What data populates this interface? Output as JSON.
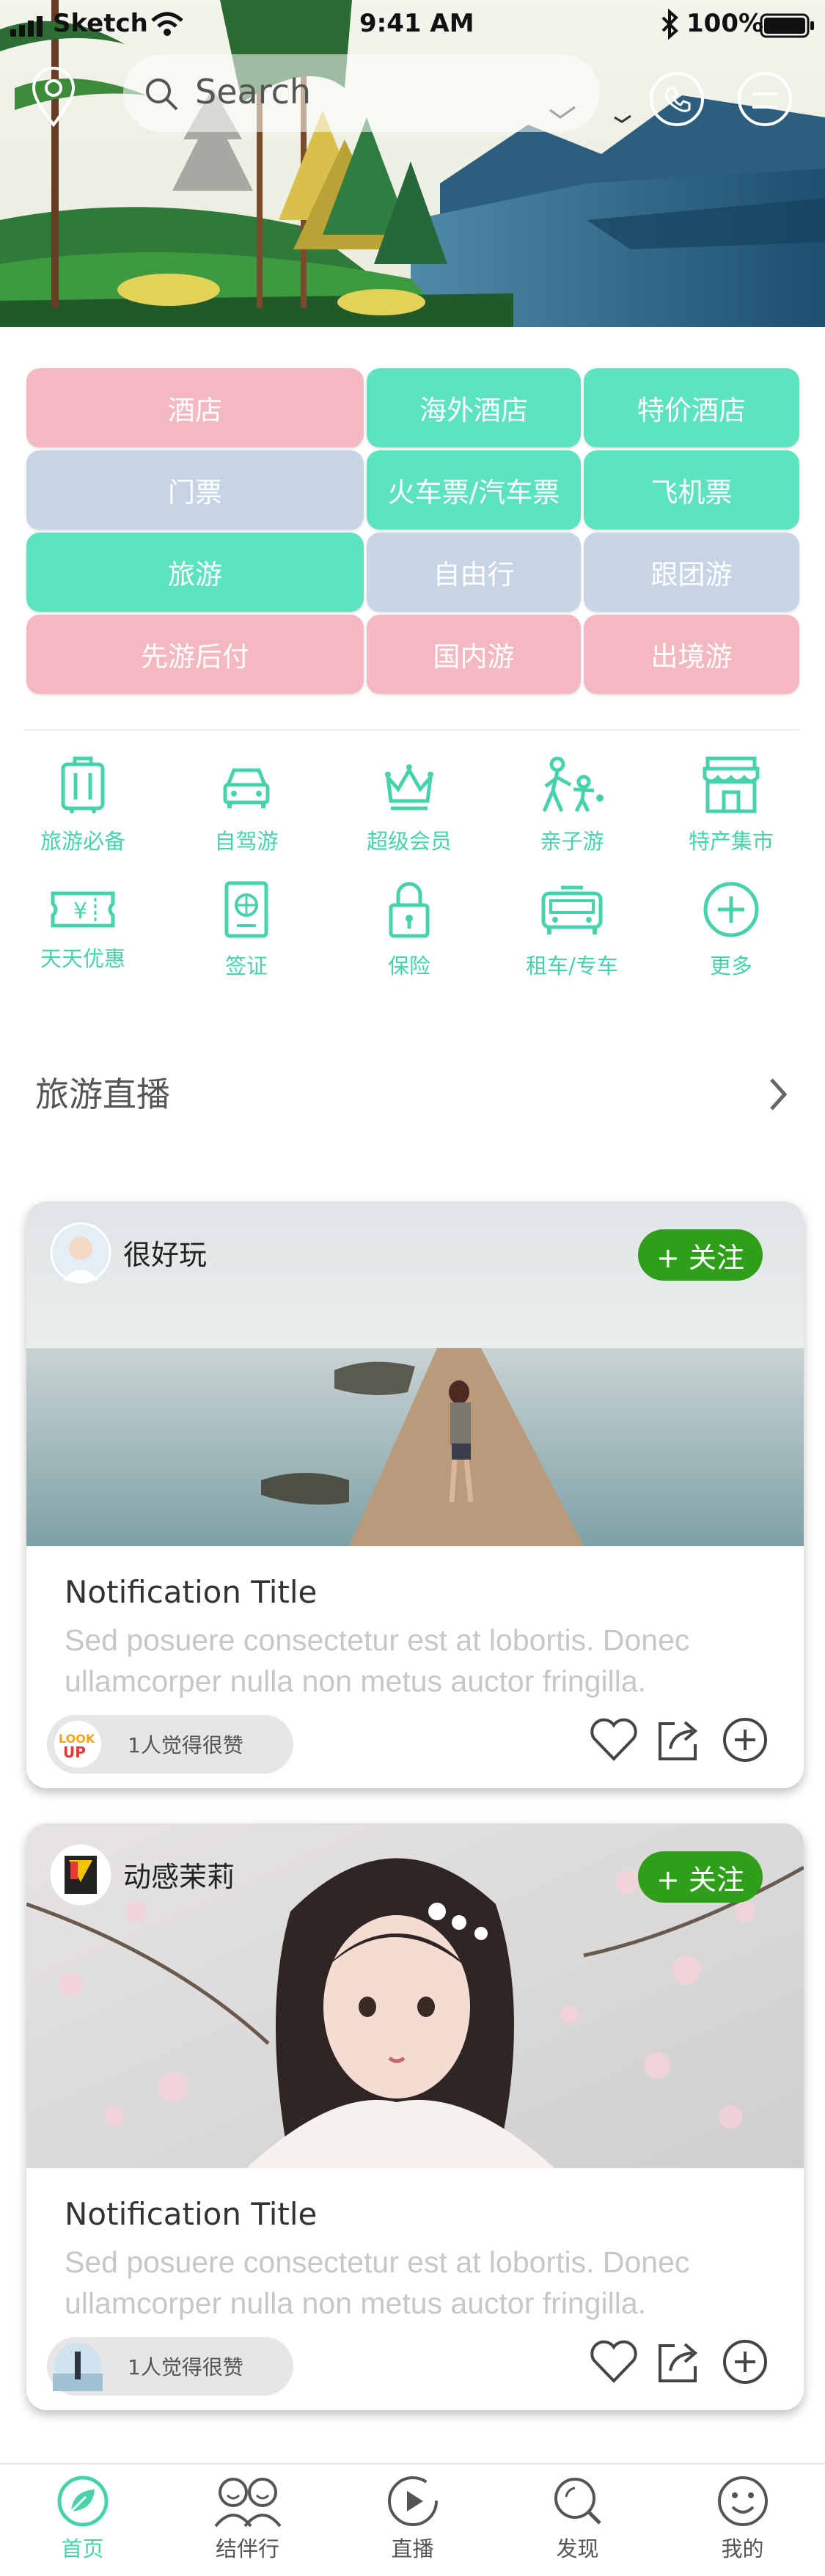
{
  "status": {
    "carrier": "Sketch",
    "time": "9:41 AM",
    "battery": "100%"
  },
  "search": {
    "placeholder": "Search"
  },
  "categories": [
    {
      "label": "酒店",
      "color": "pink"
    },
    {
      "label": "海外酒店",
      "color": "green"
    },
    {
      "label": "特价酒店",
      "color": "green"
    },
    {
      "label": "门票",
      "color": "blue"
    },
    {
      "label": "火车票/汽车票",
      "color": "green"
    },
    {
      "label": "飞机票",
      "color": "green"
    },
    {
      "label": "旅游",
      "color": "green"
    },
    {
      "label": "自由行",
      "color": "blue"
    },
    {
      "label": "跟团游",
      "color": "blue"
    },
    {
      "label": "先游后付",
      "color": "pink"
    },
    {
      "label": "国内游",
      "color": "pink"
    },
    {
      "label": "出境游",
      "color": "pink"
    }
  ],
  "services": [
    {
      "label": "旅游必备",
      "icon": "suitcase-icon"
    },
    {
      "label": "自驾游",
      "icon": "car-icon"
    },
    {
      "label": "超级会员",
      "icon": "crown-icon"
    },
    {
      "label": "亲子游",
      "icon": "family-icon"
    },
    {
      "label": "特产集市",
      "icon": "store-icon"
    },
    {
      "label": "天天优惠",
      "icon": "coupon-icon"
    },
    {
      "label": "签证",
      "icon": "passport-icon"
    },
    {
      "label": "保险",
      "icon": "lock-icon"
    },
    {
      "label": "租车/专车",
      "icon": "bus-icon"
    },
    {
      "label": "更多",
      "icon": "plus-circle-icon"
    }
  ],
  "section": {
    "title": "旅游直播"
  },
  "cards": [
    {
      "username": "很好玩",
      "follow_label": "+ 关注",
      "title": "Notification Title",
      "body_line1": "Sed posuere consectetur est at lobortis. Donec",
      "body_line2": "ullamcorper nulla non metus auctor fringilla.",
      "likes_text": "1人觉得很赞"
    },
    {
      "username": "动感茉莉",
      "follow_label": "+ 关注",
      "title": "Notification Title",
      "body_line1": "Sed posuere consectetur est at lobortis. Donec",
      "body_line2": "ullamcorper nulla non metus auctor fringilla.",
      "likes_text": "1人觉得很赞"
    }
  ],
  "tabs": [
    {
      "label": "首页",
      "icon": "home-leaf-icon",
      "active": true
    },
    {
      "label": "结伴行",
      "icon": "companions-icon",
      "active": false
    },
    {
      "label": "直播",
      "icon": "play-icon",
      "active": false
    },
    {
      "label": "发现",
      "icon": "discover-icon",
      "active": false
    },
    {
      "label": "我的",
      "icon": "smiley-icon",
      "active": false
    }
  ],
  "colors": {
    "accent_green": "#46d3ac",
    "follow_green": "#2f9f1a",
    "pink": "#f4b8c0",
    "mint": "#5de3bf",
    "blue_grey": "#c6d4e6"
  }
}
